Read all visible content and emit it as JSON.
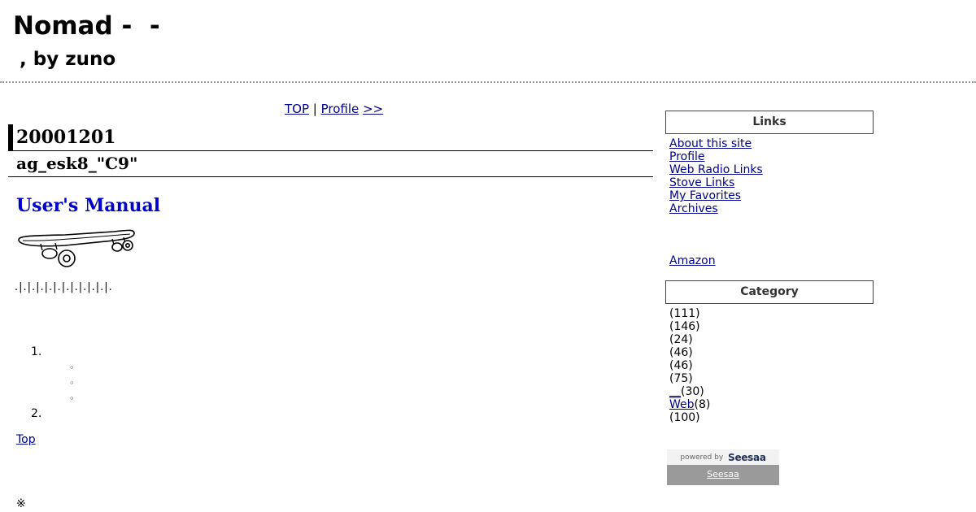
{
  "header": {
    "title": "Nomad -  -",
    "description": " , by zuno"
  },
  "nav": {
    "top": "TOP",
    "separator": "|",
    "profile": "Profile",
    "next": ">>"
  },
  "entry": {
    "date": "20001201",
    "title": "ag_esk8_\"C9\"",
    "link_title": "User's Manual",
    "image_icon": "skateboard-icon",
    "dots": ".|.|.|.|.|.|.|.|.|.|.|.",
    "list_numbers": [
      "1.",
      "2."
    ],
    "sub_bullets": [
      "◦",
      "◦",
      "◦"
    ],
    "top_link": "Top",
    "footnote": "※"
  },
  "sidebar": {
    "links_heading": "Links",
    "links": [
      "About this site",
      "Profile",
      "Web Radio Links",
      "Stove Links",
      "My Favorites",
      "Archives"
    ],
    "amazon": "Amazon",
    "category_heading": "Category",
    "categories": [
      {
        "name": "",
        "count": "(111)"
      },
      {
        "name": "",
        "count": "(146)"
      },
      {
        "name": "",
        "count": "(24)"
      },
      {
        "name": "",
        "count": "(46)"
      },
      {
        "name": "",
        "count": "(46)"
      },
      {
        "name": "",
        "count": "(75)"
      },
      {
        "name": "__",
        "count": "(30)"
      },
      {
        "name": "Web",
        "count": "(8)"
      },
      {
        "name": "",
        "count": "(100)"
      }
    ],
    "badge": {
      "powered_by": "powered by",
      "logo": "Seesaa",
      "link": "Seesaa"
    }
  }
}
